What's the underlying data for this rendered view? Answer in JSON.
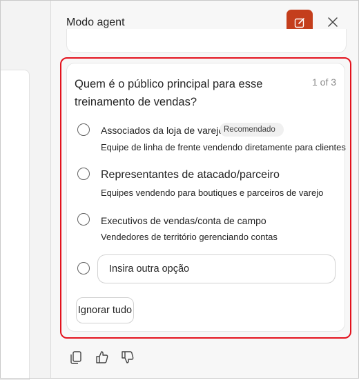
{
  "header": {
    "title": "Modo agent",
    "agent_icon": "compose-edit-icon",
    "close_icon": "close-icon",
    "accent_color": "#c43e1c"
  },
  "question_card": {
    "question": "Quem é o público principal para esse treinamento de vendas?",
    "counter": "1 of 3",
    "options": [
      {
        "title": "Associados da loja de varejo",
        "badge": "Recomendado",
        "description": "Equipe de linha de frente vendendo diretamente para clientes"
      },
      {
        "title": "Representantes de atacado/parceiro",
        "description": "Equipes vendendo para boutiques e parceiros de varejo"
      },
      {
        "title": "Executivos de vendas/conta de campo",
        "description": "Vendedores de território gerenciando contas"
      }
    ],
    "other_placeholder": "Insira outra opção",
    "skip_label": "Ignorar tudo",
    "highlight_color": "#e3121d"
  },
  "feedback": {
    "icons": [
      "copy-icon",
      "thumbs-up-icon",
      "thumbs-down-icon"
    ]
  }
}
